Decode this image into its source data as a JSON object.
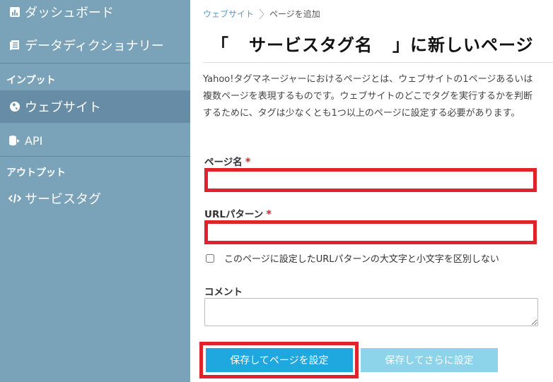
{
  "sidebar": {
    "items": [
      {
        "label": "ダッシュボード",
        "icon": "bar-chart-icon"
      },
      {
        "label": "データディクショナリー",
        "icon": "book-icon"
      },
      {
        "label": "ウェブサイト",
        "icon": "globe-icon",
        "active": true
      },
      {
        "label": "API",
        "icon": "database-arrow-icon"
      },
      {
        "label": "サービスタグ",
        "icon": "code-icon"
      }
    ],
    "sections": {
      "input": "インプット",
      "output": "アウトプット"
    }
  },
  "breadcrumb": {
    "parent": "ウェブサイト",
    "current": "ページを追加"
  },
  "page": {
    "title_open": "「",
    "title_name": "サービスタグ名",
    "title_rest": "」に新しいページ",
    "description": "Yahoo!タグマネージャーにおけるページとは、ウェブサイトの1ページあるいは複数ページを表現するものです。ウェブサイトのどこでタグを実行するかを判断するために、タグは少なくとも1つ以上のページに設定する必要があります。"
  },
  "form": {
    "page_name_label": "ページ名",
    "page_name_value": "",
    "url_pattern_label": "URLパターン",
    "url_pattern_value": "",
    "required_mark": "*",
    "case_insensitive_label": "このページに設定したURLパターンの大文字と小文字を区別しない",
    "case_insensitive_checked": false,
    "comment_label": "コメント",
    "comment_value": ""
  },
  "buttons": {
    "save_and_set_page": "保存してページを設定",
    "save_and_continue": "保存してさらに設定"
  },
  "colors": {
    "sidebar_bg": "#7aa3ba",
    "sidebar_active": "#668da5",
    "primary_button": "#1fa8e0",
    "secondary_button": "#8dd3ea",
    "highlight_red": "#e0232a",
    "required_red": "#d7262e"
  }
}
